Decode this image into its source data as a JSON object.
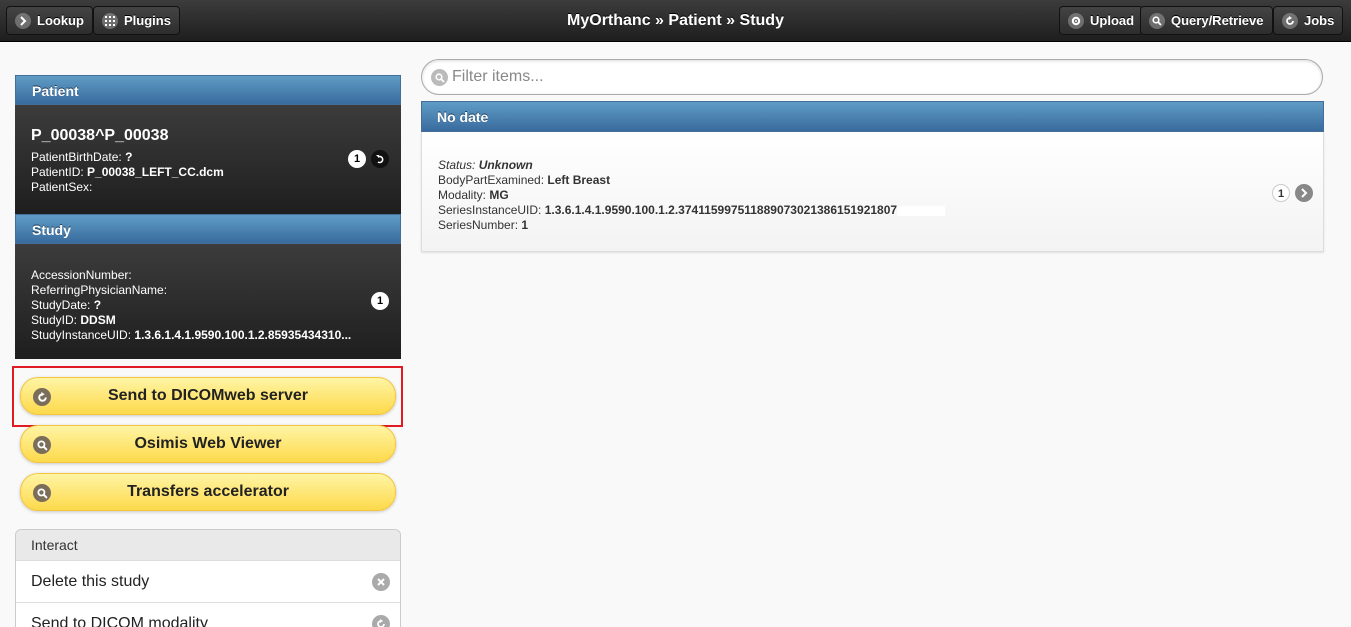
{
  "header": {
    "title": "MyOrthanc » Patient » Study",
    "left_buttons": [
      {
        "label": "Lookup",
        "icon": "chevron-right-icon"
      },
      {
        "label": "Plugins",
        "icon": "grid-icon"
      }
    ],
    "right_buttons": [
      {
        "label": "Upload",
        "icon": "gear-icon"
      },
      {
        "label": "Query/Retrieve",
        "icon": "search-icon"
      },
      {
        "label": "Jobs",
        "icon": "refresh-icon"
      }
    ]
  },
  "patient": {
    "heading": "Patient",
    "name": "P_00038^P_00038",
    "fields": [
      {
        "key": "PatientBirthDate: ",
        "value": "?"
      },
      {
        "key": "PatientID: ",
        "value": "P_00038_LEFT_CC.dcm"
      },
      {
        "key": "PatientSex: ",
        "value": ""
      }
    ],
    "count": "1"
  },
  "study": {
    "heading": "Study",
    "fields": [
      {
        "key": "AccessionNumber: ",
        "value": ""
      },
      {
        "key": "ReferringPhysicianName: ",
        "value": ""
      },
      {
        "key": "StudyDate: ",
        "value": "?"
      },
      {
        "key": "StudyID: ",
        "value": "DDSM"
      },
      {
        "key": "StudyInstanceUID: ",
        "value": "1.3.6.1.4.1.9590.100.1.2.85935434310..."
      }
    ],
    "count": "1"
  },
  "actions": [
    {
      "label": "Send to DICOMweb server",
      "icon": "refresh-icon"
    },
    {
      "label": "Osimis Web Viewer",
      "icon": "search-icon"
    },
    {
      "label": "Transfers accelerator",
      "icon": "search-icon"
    }
  ],
  "interact": {
    "heading": "Interact",
    "items": [
      {
        "label": "Delete this study",
        "icon": "close-icon"
      },
      {
        "label": "Send to DICOM modality",
        "icon": "refresh-icon"
      }
    ]
  },
  "search": {
    "placeholder": "Filter items...",
    "value": ""
  },
  "series_list": {
    "heading": "No date",
    "item": {
      "status_key": "Status: ",
      "status_value": "Unknown",
      "fields": [
        {
          "key": "BodyPartExamined: ",
          "value": "Left Breast"
        },
        {
          "key": "Modality: ",
          "value": "MG"
        },
        {
          "key": "SeriesInstanceUID: ",
          "value": "1.3.6.1.4.1.9590.100.1.2.374115997511889073021386151921807"
        },
        {
          "key": "SeriesNumber: ",
          "value": "1"
        }
      ],
      "count": "1"
    }
  }
}
